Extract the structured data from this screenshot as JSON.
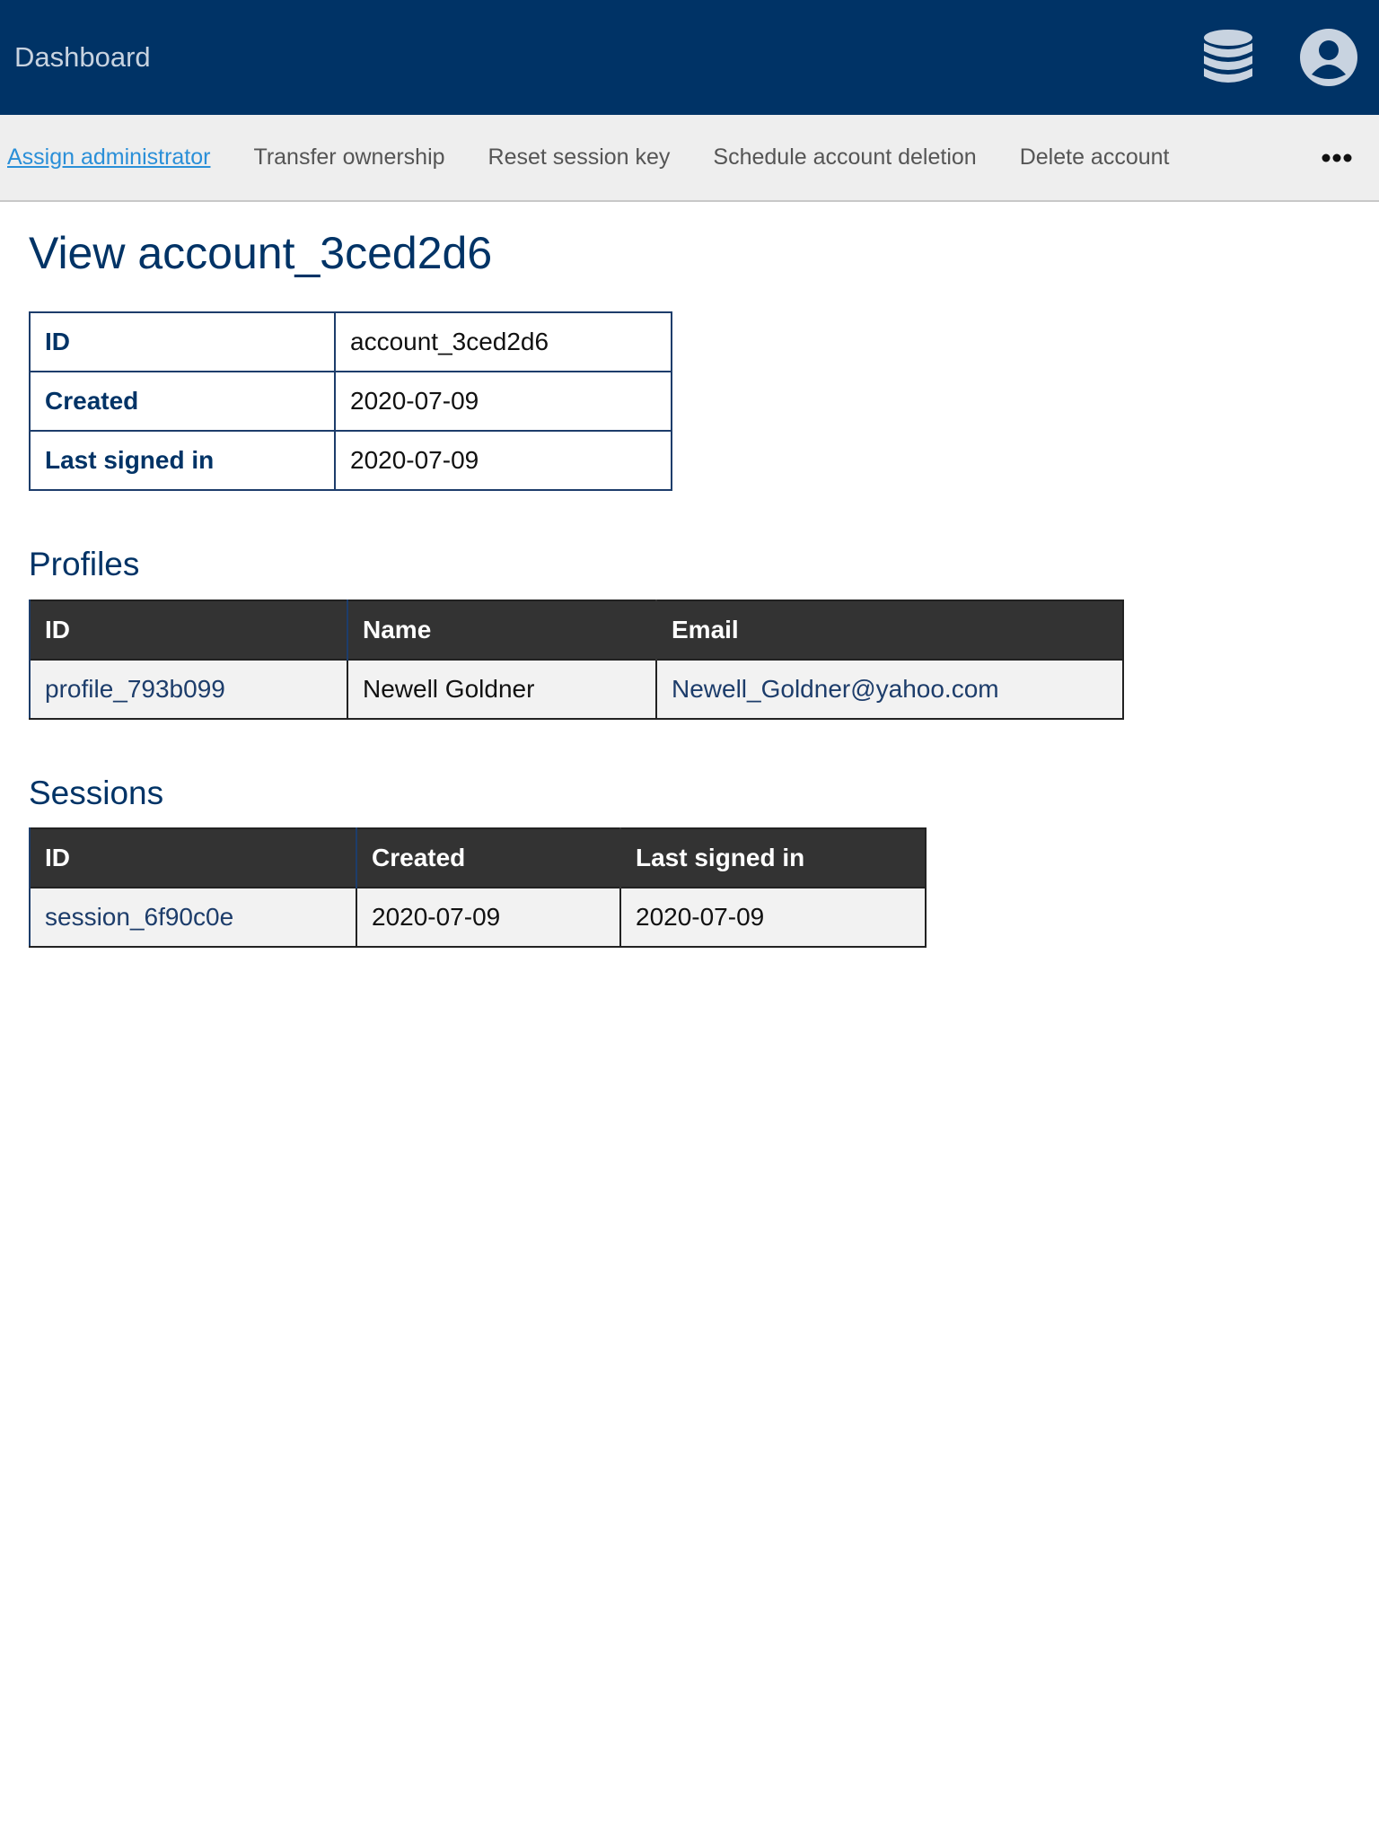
{
  "header": {
    "brand": "Dashboard",
    "icons": [
      "database-icon",
      "user-account-icon"
    ],
    "background": "#003366"
  },
  "actions": {
    "items": [
      {
        "label": "Assign administrator",
        "active": true
      },
      {
        "label": "Transfer ownership",
        "active": false
      },
      {
        "label": "Reset session key",
        "active": false
      },
      {
        "label": "Schedule account deletion",
        "active": false
      },
      {
        "label": "Delete account",
        "active": false
      }
    ],
    "more_icon": "more-horizontal-icon"
  },
  "page": {
    "title": "View account_3ced2d6"
  },
  "details": {
    "rows": [
      {
        "key": "ID",
        "value": "account_3ced2d6"
      },
      {
        "key": "Created",
        "value": "2020-07-09"
      },
      {
        "key": "Last signed in",
        "value": "2020-07-09"
      }
    ]
  },
  "profiles": {
    "title": "Profiles",
    "columns": [
      "ID",
      "Name",
      "Email"
    ],
    "rows": [
      {
        "id": "profile_793b099",
        "name": "Newell Goldner",
        "email": "Newell_Goldner@yahoo.com"
      }
    ]
  },
  "sessions": {
    "title": "Sessions",
    "columns": [
      "ID",
      "Created",
      "Last signed in"
    ],
    "rows": [
      {
        "id": "session_6f90c0e",
        "created": "2020-07-09",
        "last_signed_in": "2020-07-09"
      }
    ]
  },
  "colors": {
    "primary": "#003366",
    "link_active": "#2a8fd8",
    "table_header": "#333333"
  }
}
